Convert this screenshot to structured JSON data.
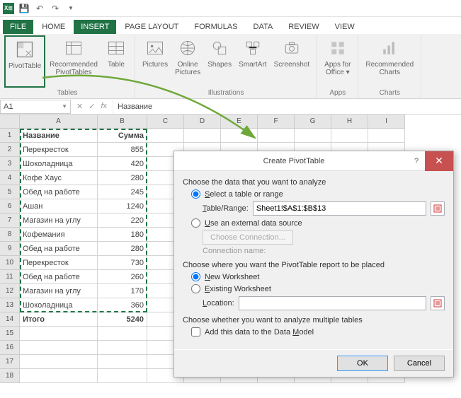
{
  "qat": {
    "xl": "X≣"
  },
  "tabs": {
    "file": "FILE",
    "home": "HOME",
    "insert": "INSERT",
    "pagelayout": "PAGE LAYOUT",
    "formulas": "FORMULAS",
    "data": "DATA",
    "review": "REVIEW",
    "view": "VIEW"
  },
  "ribbon": {
    "pivottable": "PivotTable",
    "recommended_pivot": "Recommended\nPivotTables",
    "table": "Table",
    "pictures": "Pictures",
    "online_pictures": "Online\nPictures",
    "shapes": "Shapes",
    "smartart": "SmartArt",
    "screenshot": "Screenshot",
    "apps_office": "Apps for\nOffice ▾",
    "recommended_charts": "Recommended\nCharts",
    "group_tables": "Tables",
    "group_illustrations": "Illustrations",
    "group_apps": "Apps",
    "group_charts": "Charts"
  },
  "namebox": "A1",
  "formula": "Название",
  "columns": [
    "A",
    "B",
    "C",
    "D",
    "E",
    "F",
    "G",
    "H",
    "I"
  ],
  "sheet": {
    "header": {
      "name": "Название",
      "sum": "Сумма"
    },
    "rows": [
      {
        "name": "Перекресток",
        "sum": "855"
      },
      {
        "name": "Шоколадница",
        "sum": "420"
      },
      {
        "name": "Кофе Хаус",
        "sum": "280"
      },
      {
        "name": "Обед на работе",
        "sum": "245"
      },
      {
        "name": "Ашан",
        "sum": "1240"
      },
      {
        "name": "Магазин на углу",
        "sum": "220"
      },
      {
        "name": "Кофемания",
        "sum": "180"
      },
      {
        "name": "Обед на работе",
        "sum": "280"
      },
      {
        "name": "Перекресток",
        "sum": "730"
      },
      {
        "name": "Обед на работе",
        "sum": "260"
      },
      {
        "name": "Магазин на углу",
        "sum": "170"
      },
      {
        "name": "Шоколадница",
        "sum": "360"
      }
    ],
    "total": {
      "name": "Итого",
      "sum": "5240"
    }
  },
  "dialog": {
    "title": "Create PivotTable",
    "choose_data": "Choose the data that you want to analyze",
    "select_range": "Select a table or range",
    "table_range_label": "Table/Range:",
    "table_range_value": "Sheet1!$A$1:$B$13",
    "use_external": "Use an external data source",
    "choose_connection": "Choose Connection...",
    "connection_name": "Connection name:",
    "choose_where": "Choose where you want the PivotTable report to be placed",
    "new_worksheet": "New Worksheet",
    "existing_worksheet": "Existing Worksheet",
    "location_label": "Location:",
    "location_value": "",
    "choose_multi": "Choose whether you want to analyze multiple tables",
    "add_data_model": "Add this data to the Data Model",
    "ok": "OK",
    "cancel": "Cancel"
  }
}
